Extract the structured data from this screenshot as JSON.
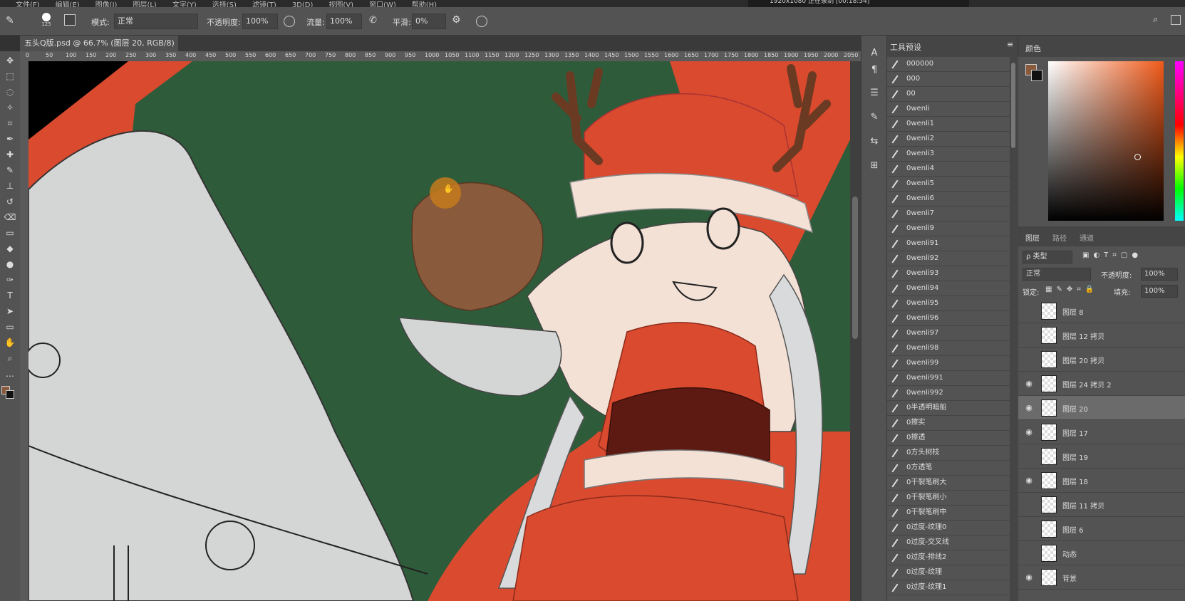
{
  "menu": [
    "文件(F)",
    "编辑(E)",
    "图像(I)",
    "图层(L)",
    "文字(Y)",
    "选择(S)",
    "滤镜(T)",
    "3D(D)",
    "视图(V)",
    "窗口(W)",
    "帮助(H)"
  ],
  "recorder": "1920x1080  正在录制 [00:18:54]",
  "options": {
    "brush_size": "125",
    "mode_label": "模式:",
    "mode_value": "正常",
    "opacity_label": "不透明度:",
    "opacity_value": "100%",
    "flow_label": "流量:",
    "flow_value": "100%",
    "smooth_label": "平滑:",
    "smooth_value": "0%"
  },
  "document_tab": "五头Q版.psd @ 66.7% (图层 20, RGB/8) *  ×",
  "ruler_ticks": [
    "0",
    "50",
    "100",
    "150",
    "200",
    "250",
    "300",
    "350",
    "400",
    "450",
    "500",
    "550",
    "600",
    "650",
    "700",
    "750",
    "800",
    "850",
    "900",
    "950",
    "1000",
    "1050",
    "1100",
    "1150",
    "1200",
    "1250",
    "1300",
    "1350",
    "1400",
    "1450",
    "1500",
    "1550",
    "1600",
    "1650",
    "1700",
    "1750",
    "1800",
    "1850",
    "1900",
    "1950",
    "2000",
    "2050"
  ],
  "tools": [
    "move-tool",
    "marquee-tool",
    "lasso-tool",
    "magic-wand-tool",
    "crop-tool",
    "eyedropper-tool",
    "healing-tool",
    "brush-tool",
    "stamp-tool",
    "history-brush-tool",
    "eraser-tool",
    "gradient-tool",
    "blur-tool",
    "dodge-tool",
    "pen-tool",
    "type-tool",
    "path-select-tool",
    "shape-tool",
    "hand-tool",
    "zoom-tool",
    "more-tools"
  ],
  "tool_presets": {
    "title": "工具预设",
    "items": [
      "000000",
      "000",
      "00",
      "0wenli",
      "0wenli1",
      "0wenli2",
      "0wenli3",
      "0wenli4",
      "0wenli5",
      "0wenli6",
      "0wenli7",
      "0wenli9",
      "0wenli91",
      "0wenli92",
      "0wenli93",
      "0wenli94",
      "0wenli95",
      "0wenli96",
      "0wenli97",
      "0wenli98",
      "0wenli99",
      "0wenli991",
      "0wenli992",
      "0半透明暗船",
      "0擦实",
      "0擦透",
      "0方头树枝",
      "0方透笔",
      "0干裂笔刷大",
      "0干裂笔刷小",
      "0干裂笔刷中",
      "0过度-纹理0",
      "0过度-交叉线",
      "0过度-排线2",
      "0过度-纹理",
      "0过度-纹理1"
    ]
  },
  "color_panel": {
    "title": "颜色",
    "foreground": "#8a5a3c",
    "background": "#111111"
  },
  "layers_panel": {
    "tabs": [
      "图层",
      "路径",
      "通道"
    ],
    "kind_filter": "ρ 类型",
    "blend_mode": "正常",
    "opacity_label": "不透明度:",
    "opacity_value": "100%",
    "lock_label": "锁定:",
    "fill_label": "填充:",
    "fill_value": "100%",
    "layers": [
      {
        "name": "图层 8",
        "visible": false,
        "selected": false
      },
      {
        "name": "图层 12 拷贝",
        "visible": false,
        "selected": false
      },
      {
        "name": "图层 20 拷贝",
        "visible": false,
        "selected": false
      },
      {
        "name": "图层 24 拷贝 2",
        "visible": true,
        "selected": false
      },
      {
        "name": "图层 20",
        "visible": true,
        "selected": true
      },
      {
        "name": "图层 17",
        "visible": true,
        "selected": false
      },
      {
        "name": "图层 19",
        "visible": false,
        "selected": false
      },
      {
        "name": "图层 18",
        "visible": true,
        "selected": false
      },
      {
        "name": "图层 11 拷贝",
        "visible": false,
        "selected": false
      },
      {
        "name": "图层 6",
        "visible": false,
        "selected": false
      },
      {
        "name": "动态",
        "visible": false,
        "selected": false
      },
      {
        "name": "背景",
        "visible": true,
        "selected": false
      }
    ]
  }
}
